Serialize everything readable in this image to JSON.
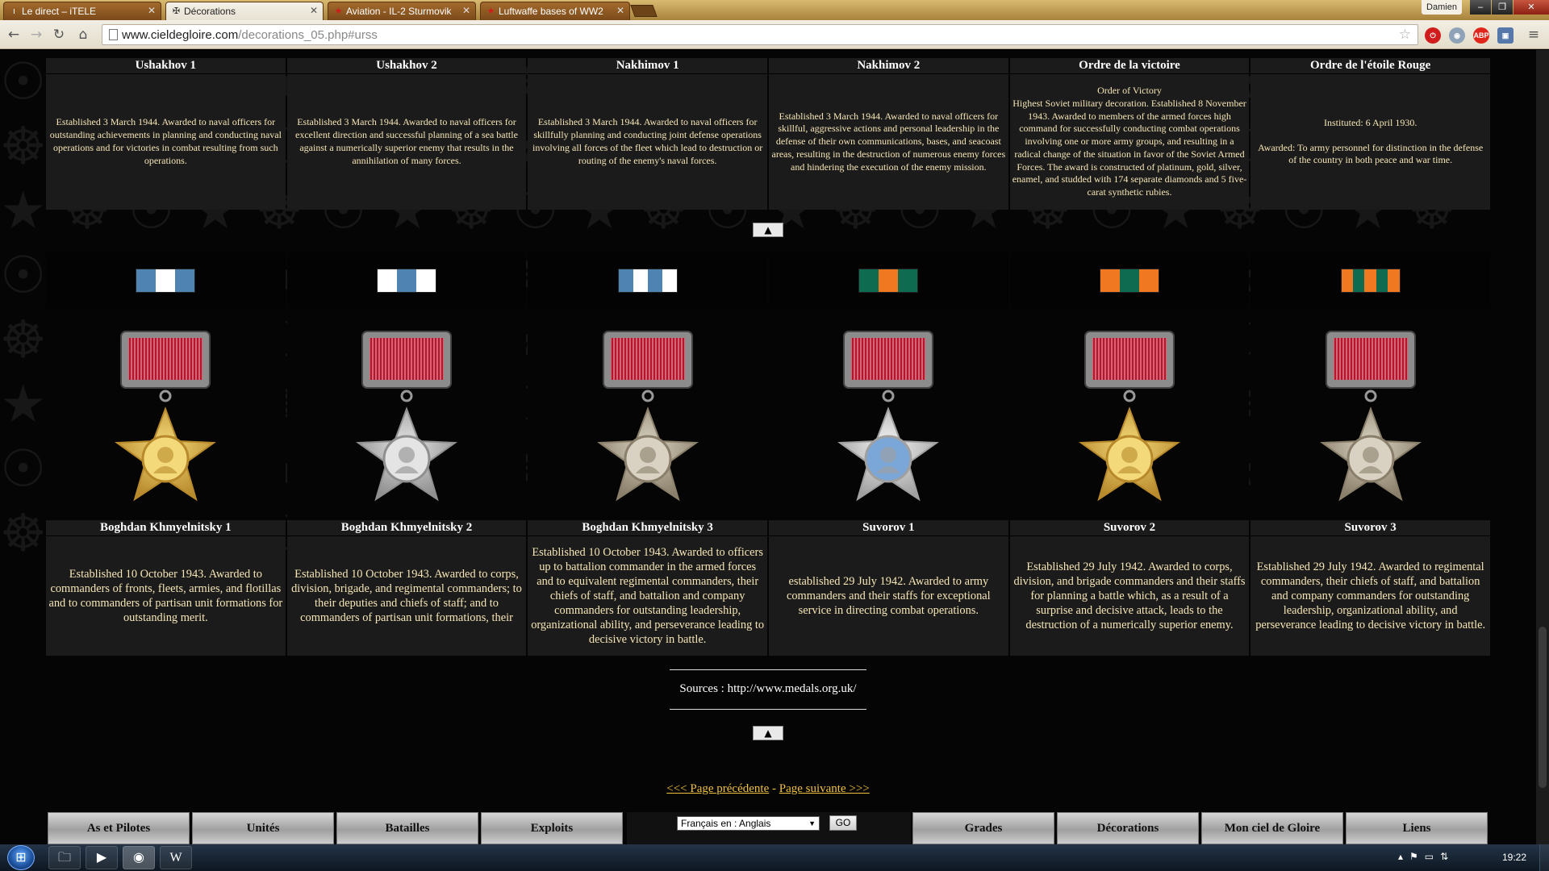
{
  "browser": {
    "tabs": [
      {
        "label": "Le direct – iTELE",
        "icon": "itele-icon",
        "active": false
      },
      {
        "label": "Décorations",
        "icon": "site-icon",
        "active": true
      },
      {
        "label": "Aviation - IL-2 Sturmovik",
        "icon": "star-icon",
        "active": false
      },
      {
        "label": "Luftwaffe bases of WW2",
        "icon": "star-icon",
        "active": false
      }
    ],
    "user": "Damien",
    "url_host": "www.cieldegloire.com",
    "url_path": "/decorations_05.php#urss",
    "extensions": [
      "ABP"
    ]
  },
  "top_section": {
    "titles": [
      "Ushakhov 1",
      "Ushakhov 2",
      "Nakhimov 1",
      "Nakhimov 2",
      "Ordre de la victoire",
      "Ordre de l'étoile Rouge"
    ],
    "descriptions": [
      [
        "Established 3 March 1944. Awarded to naval officers for outstanding achievements in planning and conducting naval operations and for victories in combat resulting from such operations."
      ],
      [
        "Established 3 March 1944. Awarded to naval officers for excellent direction and successful planning of a sea battle against a numerically superior enemy that results in the annihilation of many forces."
      ],
      [
        "Established 3 March 1944. Awarded to naval officers for skillfully planning and conducting joint defense operations involving all forces of the fleet which lead to destruction or routing of the enemy's naval forces."
      ],
      [
        "Established 3 March 1944. Awarded to naval officers for skillful, aggressive actions and personal leadership in the defense of their own communications, bases, and seacoast areas, resulting in the destruction of numerous enemy forces and hindering the execution of the enemy mission."
      ],
      [
        "Order of Victory",
        "Highest Soviet military decoration. Established 8 November 1943. Awarded to members of the armed forces high command for successfully conducting combat operations involving one or more army groups, and resulting in a radical change of the situation in favor of the Soviet Armed Forces. The award is constructed of platinum, gold, silver, enamel, and studded with 174 separate diamonds and 5 five-carat synthetic rubies."
      ],
      [
        "Instituted: 6 April 1930.",
        "",
        "Awarded: To army personnel for distinction in the defense of the country in both peace and war time."
      ]
    ]
  },
  "up_button_label": "▲",
  "medals": [
    {
      "name": "Boghdan Khmyelnitsky 1",
      "ribbon": [
        "#4f84b2",
        "#ffffff",
        "#4f84b2"
      ],
      "metal": "gold",
      "description": "Established 10 October 1943. Awarded to commanders of fronts, fleets, armies, and flotillas and to commanders of partisan unit formations for outstanding merit."
    },
    {
      "name": "Boghdan Khmyelnitsky 2",
      "ribbon": [
        "#ffffff",
        "#4f84b2",
        "#ffffff"
      ],
      "metal": "silver-gold",
      "description": "Established 10 October 1943. Awarded to corps, division, brigade, and regimental commanders; to their deputies and chiefs of staff; and to commanders of partisan unit formations, their"
    },
    {
      "name": "Boghdan Khmyelnitsky 3",
      "ribbon": [
        "#4f84b2",
        "#ffffff",
        "#4f84b2",
        "#ffffff"
      ],
      "metal": "silver",
      "description": "Established 10 October 1943. Awarded to officers up to battalion commander in the armed forces and to equivalent regimental commanders, their chiefs of staff, and battalion and company commanders for outstanding leadership, organizational ability, and perseverance leading to decisive victory in battle."
    },
    {
      "name": "Suvorov 1",
      "ribbon": [
        "#0e6b4f",
        "#f07820",
        "#0e6b4f"
      ],
      "metal": "platinum",
      "description": "established 29 July 1942. Awarded to army commanders and their staffs for exceptional service in directing combat operations."
    },
    {
      "name": "Suvorov 2",
      "ribbon": [
        "#f07820",
        "#0e6b4f",
        "#f07820"
      ],
      "metal": "gold",
      "description": "Established 29 July 1942. Awarded to corps, division, and brigade commanders and their staffs for planning a battle which, as a result of a surprise and decisive attack, leads to the destruction of a numerically superior enemy."
    },
    {
      "name": "Suvorov 3",
      "ribbon": [
        "#f07820",
        "#0e6b4f",
        "#f07820",
        "#0e6b4f",
        "#f07820"
      ],
      "metal": "silver",
      "description": "Established 29 July 1942. Awarded to regimental commanders, their chiefs of staff, and battalion and company commanders for outstanding leadership, organizational ability, and perseverance leading to decisive victory in battle."
    }
  ],
  "sources": "Sources : http://www.medals.org.uk/",
  "pager": {
    "prev": "<<< Page précédente",
    "sep": " - ",
    "next": "Page suivante >>>"
  },
  "footer": {
    "left": [
      "As et Pilotes",
      "Unités",
      "Batailles",
      "Exploits"
    ],
    "right": [
      "Grades",
      "Décorations",
      "Mon ciel de Gloire",
      "Liens"
    ],
    "language_select": "Français en : Anglais",
    "go_label": "GO"
  },
  "taskbar": {
    "clock": "19:22",
    "apps": [
      "folder-icon",
      "media-player-icon",
      "chrome-icon",
      "word-icon"
    ]
  },
  "colors": {
    "title_text": "#ffffff",
    "body_text": "#f6e6b6",
    "link": "#f0c040",
    "cell_bg": "#1b1b1b"
  }
}
